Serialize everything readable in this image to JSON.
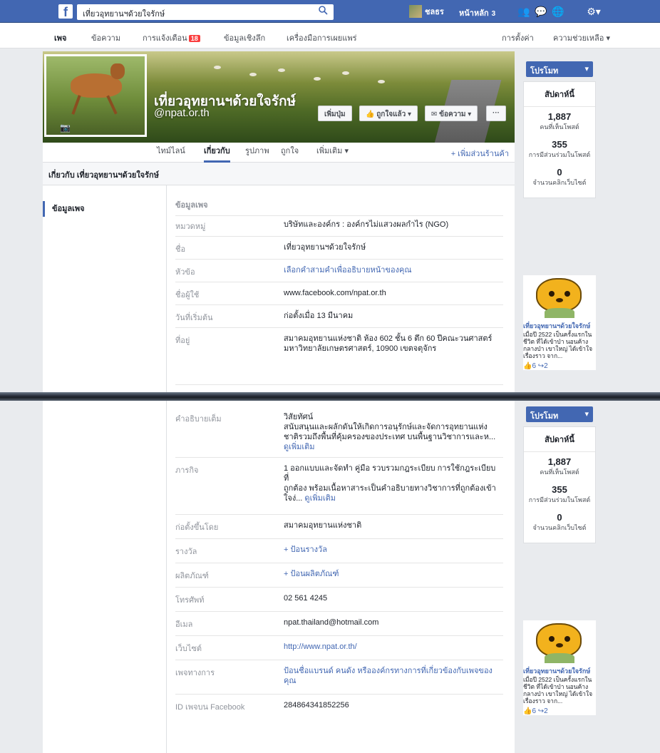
{
  "topbar": {
    "search_value": "เที่ยวอุทยานฯด้วยใจรักษ์",
    "user_name": "ชลธร",
    "home_label": "หน้าหลัก",
    "home_count": "3"
  },
  "pagenav": {
    "items": [
      "เพจ",
      "ข้อความ",
      "การแจ้งเตือน",
      "ข้อมูลเชิงลึก",
      "เครื่องมือการเผยแพร่"
    ],
    "notif_count": "18",
    "settings": "การตั้งค่า",
    "help": "ความช่วยเหลือ ▾"
  },
  "page": {
    "title": "เที่ยวอุทยานฯด้วยใจรักษ์",
    "handle": "@npat.or.th",
    "buttons": {
      "add_button": "เพิ่มปุ่ม",
      "liked": "ถูกใจแล้ว ▾",
      "message": "ข้อความ ▾",
      "more": "···"
    },
    "tabs": [
      "ไทม์ไลน์",
      "เกี่ยวกับ",
      "รูปภาพ",
      "ถูกใจ",
      "เพิ่มเติม ▾"
    ],
    "add_shop": "+ เพิ่มส่วนร้านค้า"
  },
  "about": {
    "header": "เกี่ยวกับ เที่ยวอุทยานฯด้วยใจรักษ์",
    "left_nav": "ข้อมูลเพจ",
    "section_label": "ข้อมูลเพจ",
    "rows1": [
      {
        "label": "หมวดหมู่",
        "value": "บริษัทและองค์กร : องค์กรไม่แสวงผลกำไร (NGO)"
      },
      {
        "label": "ชื่อ",
        "value": "เที่ยวอุทยานฯด้วยใจรักษ์"
      },
      {
        "label": "หัวข้อ",
        "value": "เลือกคำสามคำเพื่ออธิบายหน้าของคุณ"
      },
      {
        "label": "ชื่อผู้ใช้",
        "value": "www.facebook.com/npat.or.th"
      },
      {
        "label": "วันที่เริ่มต้น",
        "value": "ก่อตั้งเมื่อ 13 มีนาคม"
      },
      {
        "label": "ที่อยู่",
        "value": "สมาคมอุทยานแห่งชาติ ห้อง 602 ชั้น 6 ตึก 60 ปีคณะวนศาสตร์ มหาวิทยาลัยเกษตรศาสตร์, 10900 เขตจตุจักร"
      }
    ],
    "rows2": [
      {
        "label": "คำอธิบายเต็ม",
        "value": "วิสัยทัศน์\nสนับสนุนและผลักดันให้เกิดการอนุรักษ์และจัดการอุทยานแห่งชาติรวมถึงพื้นที่คุ้มครองของประเทศ บนพื้นฐานวิชาการและห...",
        "more": "ดูเพิ่มเติม"
      },
      {
        "label": "ภารกิจ",
        "value": "1 ออกแบบและจัดทำ คู่มือ รวบรวมกฎระเบียบ การใช้กฎระเบียบที่\nถูกต้อง พร้อมเนื้อหาสาระเป็นคำอธิบายทางวิชาการที่ถูกต้องเข้าใจง่...",
        "more": "ดูเพิ่มเติม"
      },
      {
        "label": "ก่อตั้งขึ้นโดย",
        "value": "สมาคมอุทยานแห่งชาติ"
      },
      {
        "label": "รางวัล",
        "value": "+ ป้อนรางวัล"
      },
      {
        "label": "ผลิตภัณฑ์",
        "value": "+ ป้อนผลิตภัณฑ์"
      },
      {
        "label": "โทรศัพท์",
        "value": "02 561 4245"
      },
      {
        "label": "อีเมล",
        "value": "npat.thailand@hotmail.com"
      },
      {
        "label": "เว็บไซต์",
        "value": "http://www.npat.or.th/"
      },
      {
        "label": "เพจทางการ",
        "value": "ป้อนชื่อแบรนด์ คนดัง หรือองค์กรทางการที่เกี่ยวข้องกับเพจของคุณ"
      },
      {
        "label": "ID เพจบน Facebook",
        "value": "284864341852256"
      }
    ]
  },
  "rail": {
    "promote": "โปรโมท",
    "week_title": "สัปดาห์นี้",
    "stats": [
      {
        "num": "1,887",
        "cap": "คนที่เห็นโพสต์"
      },
      {
        "num": "355",
        "cap": "การมีส่วนร่วมในโพสต์"
      },
      {
        "num": "0",
        "cap": "จำนวนคลิกเว็บไซต์"
      }
    ],
    "post_name": "เที่ยวอุทยานฯด้วยใจรักษ์",
    "post_text": "เมื่อปี 2522 เป็นครั้งแรกในชีวิต ที่ได้เข้าป่า นอนค้างกลางป่า เขาใหญ่ ได้เข้าใจเรื่องราว จาก...",
    "reactions": "👍6 ↪2"
  },
  "colors": {
    "brand": "#4267b2",
    "badge": "#fa3e3e"
  }
}
